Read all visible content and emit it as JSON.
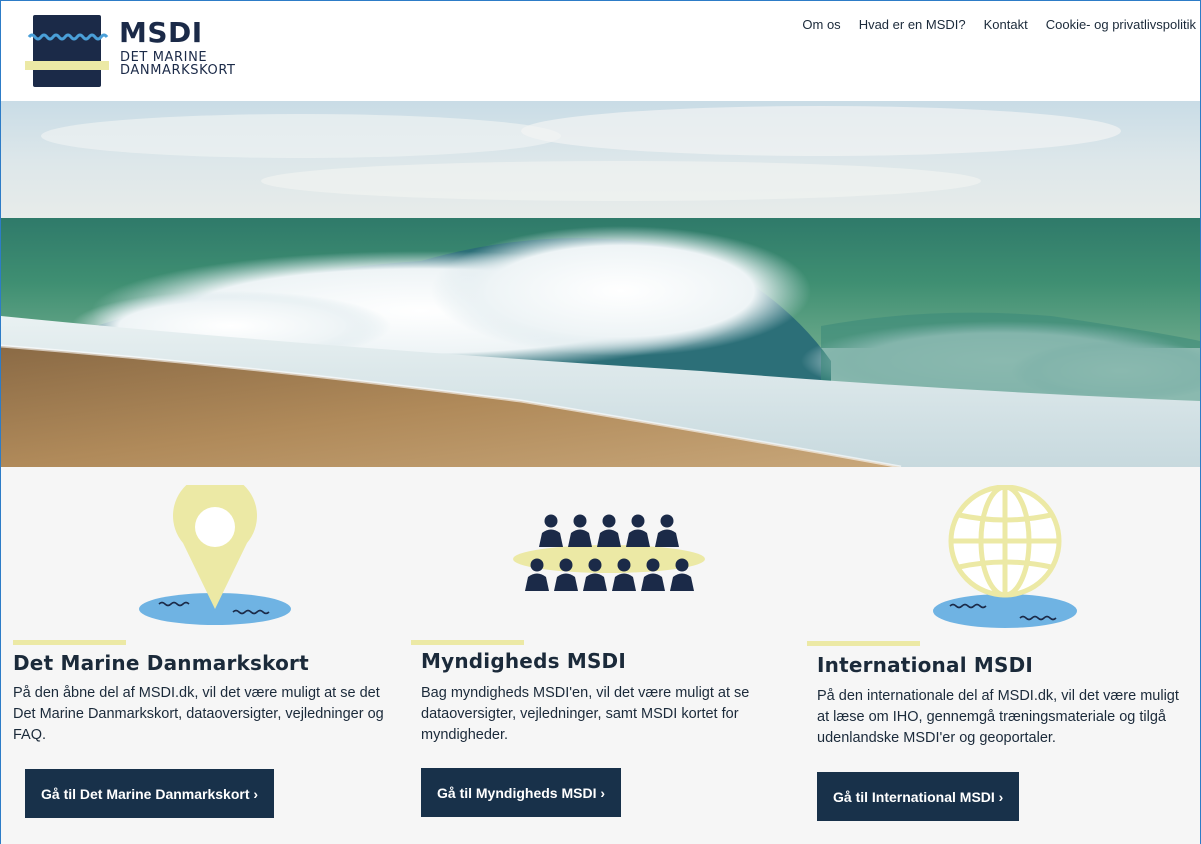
{
  "header": {
    "logo": {
      "title": "MSDI",
      "subtitle_line1": "DET MARINE",
      "subtitle_line2": "DANMARKSKORT"
    },
    "nav": [
      {
        "label": "Om os"
      },
      {
        "label": "Hvad er en MSDI?"
      },
      {
        "label": "Kontakt"
      },
      {
        "label": "Cookie- og privatlivspolitik"
      }
    ]
  },
  "hero": {
    "image": "ocean-wave-beach"
  },
  "sections": [
    {
      "icon": "map-pin-icon",
      "title": "Det Marine Danmarkskort",
      "text": "På den åbne del af MSDI.dk, vil det være muligt at se det Det Marine Danmarkskort, dataoversigter, vejledninger og FAQ.",
      "button": "Gå til Det Marine Danmarkskort ›"
    },
    {
      "icon": "people-group-icon",
      "title": "Myndigheds MSDI",
      "text": "Bag myndigheds MSDI'en, vil det være muligt at se dataoversigter, vejledninger, samt MSDI kortet for myndigheder.",
      "button": "Gå til Myndigheds MSDI ›"
    },
    {
      "icon": "globe-icon",
      "title": "International MSDI",
      "text": "På den internationale del af MSDI.dk, vil det være muligt at læse om IHO, gennemgå træningsmateriale og tilgå udenlandske MSDI'er og geoportaler.",
      "button": "Gå til International MSDI ›"
    }
  ],
  "colors": {
    "navy": "#18314a",
    "accent_yellow": "#ece9a5",
    "water_blue": "#6fb3e3",
    "background": "#f6f6f6"
  }
}
